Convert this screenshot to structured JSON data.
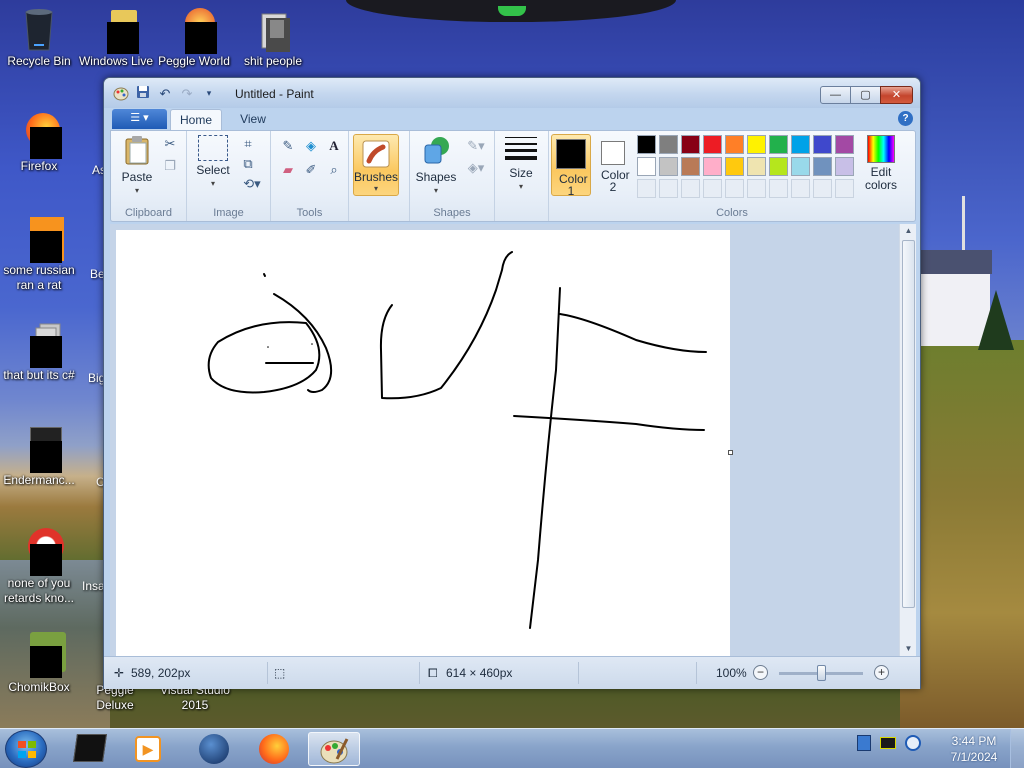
{
  "desktop": {
    "icons": [
      {
        "label": "Recycle Bin",
        "icon": "recycle-bin-icon"
      },
      {
        "label": "Windows Live",
        "icon": "windows-live-icon"
      },
      {
        "label": "Peggle World",
        "icon": "peggle-world-icon"
      },
      {
        "label": "shit people",
        "icon": "folder-icon"
      },
      {
        "label": "Firefox",
        "icon": "firefox-icon"
      },
      {
        "label": "some russian ran a rat",
        "icon": "app-icon"
      },
      {
        "label": "that but its c#",
        "icon": "copy-icon"
      },
      {
        "label": "Endermanc...",
        "icon": "app-icon"
      },
      {
        "label": "none of you retards kno...",
        "icon": "app-icon"
      },
      {
        "label": "ChomikBox",
        "icon": "chomikbox-icon"
      },
      {
        "label": "Peggle Deluxe",
        "icon": "peggle-icon"
      },
      {
        "label": "Visual Studio 2015",
        "icon": "visual-studio-icon"
      }
    ],
    "partial_labels": [
      "As",
      "Be",
      "Big",
      "C",
      "Insa"
    ]
  },
  "window": {
    "title": "Untitled - Paint",
    "controls": {
      "minimize": "—",
      "maximize": "▢",
      "close": "✕"
    }
  },
  "tabs": [
    {
      "label": "Home",
      "active": true
    },
    {
      "label": "View",
      "active": false
    }
  ],
  "ribbon": {
    "groups": [
      {
        "label": "Clipboard"
      },
      {
        "label": "Image"
      },
      {
        "label": "Tools"
      },
      {
        "label": "Shapes"
      },
      {
        "label": "Colors"
      }
    ],
    "paste_label": "Paste",
    "select_label": "Select",
    "brushes_label": "Brushes",
    "shapes_label": "Shapes",
    "size_label": "Size",
    "color1_label": "Color 1",
    "color2_label": "Color 2",
    "edit_colors_label": "Edit colors",
    "color1_value": "#000000",
    "color2_value": "#ffffff",
    "palette": [
      "#000000",
      "#7f7f7f",
      "#880015",
      "#ed1c24",
      "#ff7f27",
      "#fff200",
      "#22b14c",
      "#00a2e8",
      "#3f48cc",
      "#a349a4",
      "#ffffff",
      "#c3c3c3",
      "#b97a57",
      "#ffaec9",
      "#ffc90e",
      "#efe4b0",
      "#b5e61d",
      "#99d9ea",
      "#7092be",
      "#c8bfe7",
      "",
      "",
      "",
      "",
      "",
      "",
      "",
      "",
      "",
      ""
    ]
  },
  "status": {
    "cursor_pos": "589, 202px",
    "selection_size": "",
    "canvas_size": "614 × 460px",
    "zoom": "100%"
  },
  "taskbar": {
    "clock_time": "3:44 PM",
    "clock_date": "7/1/2024",
    "pinned": [
      "cmd-icon",
      "media-player-icon",
      "globe-icon",
      "firefox-icon",
      "paint-icon"
    ]
  }
}
